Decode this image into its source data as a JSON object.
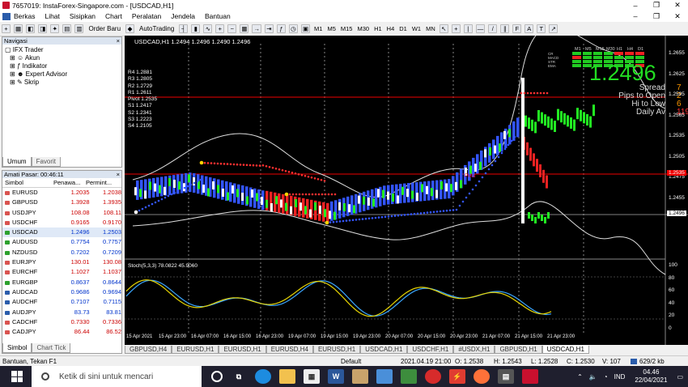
{
  "window": {
    "title": "7657019: InstaForex-Singapore.com - [USDCAD,H1]",
    "min": "–",
    "restore": "❐",
    "close": "✕"
  },
  "menu": [
    "Berkas",
    "Lihat",
    "Sisipkan",
    "Chart",
    "Peralatan",
    "Jendela",
    "Bantuan"
  ],
  "toolbar": {
    "order": "Order Baru",
    "auto": "AutoTrading",
    "timeframes": [
      "M1",
      "M5",
      "M15",
      "M30",
      "H1",
      "H4",
      "D1",
      "W1",
      "MN"
    ]
  },
  "navigator": {
    "title": "Navigasi",
    "items": [
      "IFX Trader",
      "Akun",
      "Indikator",
      "Expert Advisor",
      "Skrip"
    ],
    "tabs": [
      "Umum",
      "Favorit"
    ]
  },
  "market_watch": {
    "title": "Amati Pasar: 00:46:11",
    "columns": [
      "Simbol",
      "Penawa...",
      "Permint..."
    ],
    "rows": [
      {
        "sym": "EURUSD",
        "bid": "1.2035",
        "ask": "1.2038",
        "color": "#d9534f"
      },
      {
        "sym": "GBPUSD",
        "bid": "1.3928",
        "ask": "1.3935",
        "color": "#d9534f"
      },
      {
        "sym": "USDJPY",
        "bid": "108.08",
        "ask": "108.11",
        "color": "#d9534f"
      },
      {
        "sym": "USDCHF",
        "bid": "0.9165",
        "ask": "0.9170",
        "color": "#d9534f"
      },
      {
        "sym": "USDCAD",
        "bid": "1.2496",
        "ask": "1.2503",
        "color": "#2ca02c"
      },
      {
        "sym": "AUDUSD",
        "bid": "0.7754",
        "ask": "0.7757",
        "color": "#2ca02c"
      },
      {
        "sym": "NZDUSD",
        "bid": "0.7202",
        "ask": "0.7209",
        "color": "#2ca02c"
      },
      {
        "sym": "EURJPY",
        "bid": "130.01",
        "ask": "130.08",
        "color": "#d9534f"
      },
      {
        "sym": "EURCHF",
        "bid": "1.1027",
        "ask": "1.1037",
        "color": "#d9534f"
      },
      {
        "sym": "EURGBP",
        "bid": "0.8637",
        "ask": "0.8644",
        "color": "#2ca02c"
      },
      {
        "sym": "AUDCAD",
        "bid": "0.9686",
        "ask": "0.9694",
        "color": "#2a5cab"
      },
      {
        "sym": "AUDCHF",
        "bid": "0.7107",
        "ask": "0.7115",
        "color": "#2a5cab"
      },
      {
        "sym": "AUDJPY",
        "bid": "83.73",
        "ask": "83.81",
        "color": "#2a5cab"
      },
      {
        "sym": "CADCHF",
        "bid": "0.7330",
        "ask": "0.7336",
        "color": "#d9534f"
      },
      {
        "sym": "CADJPY",
        "bid": "86.44",
        "ask": "86.52",
        "color": "#d9534f"
      }
    ],
    "tabs": [
      "Simbol",
      "Chart Tick"
    ]
  },
  "chart": {
    "header": "USDCAD,H1  1.2494 1.2496 1.2490 1.2496",
    "pivots": [
      "R4 1.2881",
      "R3 1.2805",
      "R2 1.2729",
      "R1 1.2611",
      "Pivot 1.2535",
      "S1 1.2417",
      "S2 1.2341",
      "S3 1.2223",
      "S4 1.2105"
    ],
    "big_price": "1.2496",
    "info": [
      {
        "label": "Spread",
        "value": "7"
      },
      {
        "label": "Pips to Open",
        "value": "2"
      },
      {
        "label": "Hi to Low",
        "value": "6"
      },
      {
        "label": "Daily Av",
        "value": "119"
      }
    ],
    "matrix_cols": [
      "M1",
      "M5",
      "M15",
      "M30",
      "H1",
      "H4",
      "D1"
    ],
    "matrix_rows": [
      "CR",
      "MACD",
      "STR",
      "EMA"
    ],
    "pivot_tag": "Pivot",
    "price_ticks": [
      "1.2655",
      "1.2625",
      "1.2595",
      "1.2565",
      "1.2535",
      "1.2505",
      "1.2475",
      "1.2455"
    ],
    "right_labels": [
      "1.2535",
      "1.2496"
    ],
    "osc_label": "Stoch(5,3,3) 78.0822 45.9060",
    "osc_ticks": [
      "100",
      "80",
      "60",
      "40",
      "20",
      "0"
    ],
    "time_labels": [
      "15 Apr 2021",
      "15 Apr 23:00",
      "16 Apr 07:00",
      "16 Apr 15:00",
      "16 Apr 23:00",
      "19 Apr 07:00",
      "19 Apr 15:00",
      "19 Apr 23:00",
      "20 Apr 07:00",
      "20 Apr 15:00",
      "20 Apr 23:00",
      "21 Apr 07:00",
      "21 Apr 15:00",
      "21 Apr 23:00"
    ]
  },
  "chart_tabs": [
    "GBPUSD,H4",
    "EURUSD,H1",
    "EURUSD,H1",
    "EURUSD,H4",
    "EURUSD,H1",
    "USDCAD,H1",
    "USDCHF,H1",
    "#USDX,H1",
    "GBPUSD,H1",
    "USDCAD,H1"
  ],
  "status": {
    "help": "Bantuan, Tekan F1",
    "profile": "Default",
    "time": "2021.04.19 21:00",
    "o": "O: 1.2538",
    "h": "H: 1.2543",
    "l": "L: 1.2528",
    "c": "C: 1.2530",
    "v": "V: 107",
    "conn": "629/2 kb"
  },
  "taskbar": {
    "search": "Ketik di sini untuk mencari",
    "lang": "IND",
    "time": "04.46",
    "date": "22/04/2021"
  }
}
